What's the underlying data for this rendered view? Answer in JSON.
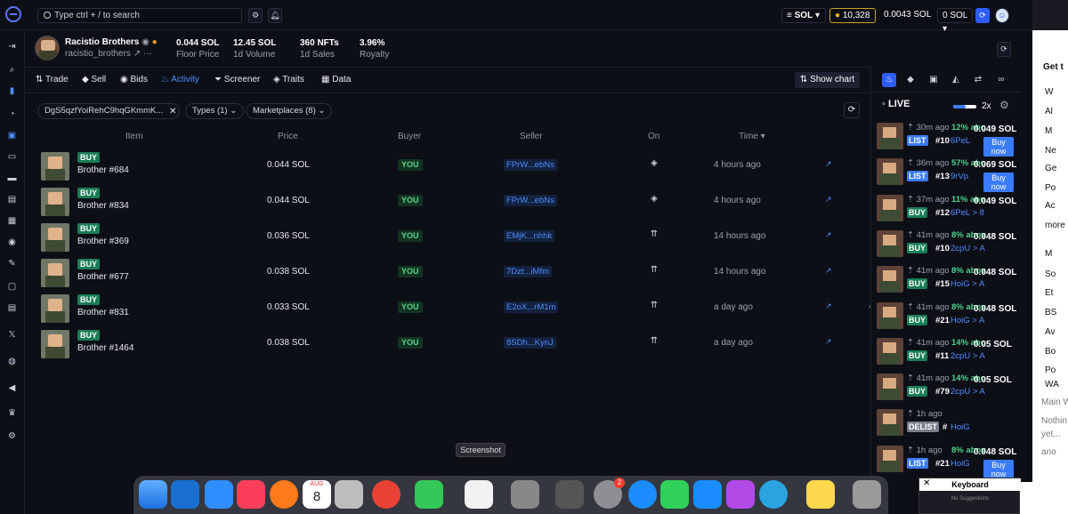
{
  "search": {
    "label": "Type  ctrl + /  to search"
  },
  "topbar": {
    "currency": "SOL",
    "points": "10,328",
    "balance1": "0.0043 SOL",
    "balance2": "0 SOL"
  },
  "collection": {
    "name": "Racistio Brothers",
    "slug": "racistio_brothers",
    "stats": [
      {
        "value": "0.044 SOL",
        "label": "Floor Price"
      },
      {
        "value": "12.45 SOL",
        "label": "1d Volume"
      },
      {
        "value": "360 NFTs",
        "label": "1d Sales"
      },
      {
        "value": "3.96%",
        "label": "Royalty"
      }
    ]
  },
  "tabs": [
    "Trade",
    "Sell",
    "Bids",
    "Activity",
    "Screener",
    "Traits",
    "Data"
  ],
  "active_tab": "Activity",
  "show_chart": "Show chart",
  "filters": {
    "address": "DgS5qzfYoiRehC9hqGKmmK...",
    "types": "Types (1)",
    "marketplaces": "Marketplaces (8)"
  },
  "columns": [
    "Item",
    "Price",
    "Buyer",
    "Seller",
    "On",
    "Time"
  ],
  "rows": [
    {
      "badge": "BUY",
      "name": "Brother #684",
      "price": "0.044 SOL",
      "buyer": "YOU",
      "seller": "FPrW...ebNs",
      "time": "4 hours ago"
    },
    {
      "badge": "BUY",
      "name": "Brother #834",
      "price": "0.044 SOL",
      "buyer": "YOU",
      "seller": "FPrW...ebNs",
      "time": "4 hours ago"
    },
    {
      "badge": "BUY",
      "name": "Brother #369",
      "price": "0.036 SOL",
      "buyer": "YOU",
      "seller": "EMjK...nhhk",
      "time": "14 hours ago"
    },
    {
      "badge": "BUY",
      "name": "Brother #677",
      "price": "0.038 SOL",
      "buyer": "YOU",
      "seller": "7Dzt...iMfm",
      "time": "14 hours ago"
    },
    {
      "badge": "BUY",
      "name": "Brother #831",
      "price": "0.033 SOL",
      "buyer": "YOU",
      "seller": "E2oX...rM1m",
      "time": "a day ago"
    },
    {
      "badge": "BUY",
      "name": "Brother #1464",
      "price": "0.038 SOL",
      "buyer": "YOU",
      "seller": "8SDh...KynJ",
      "time": "a day ago"
    }
  ],
  "live": {
    "title": "LIVE",
    "speed": "2x",
    "items": [
      {
        "ago": "30m ago",
        "pct": "12% abo",
        "price": "0.049 SOL",
        "badge": "LIST",
        "num": "#10",
        "who": "6PeL",
        "buynow": true
      },
      {
        "ago": "36m ago",
        "pct": "57% abo",
        "price": "0.069 SOL",
        "badge": "LIST",
        "num": "#13",
        "who": "9rVp",
        "buynow": true
      },
      {
        "ago": "37m ago",
        "pct": "11% abo",
        "price": "0.049 SOL",
        "badge": "BUY",
        "num": "#12",
        "who": "6PeL > 8",
        "buynow": false
      },
      {
        "ago": "41m ago",
        "pct": "8% abov",
        "price": "0.048 SOL",
        "badge": "BUY",
        "num": "#10",
        "who": "2cpU > A",
        "buynow": false
      },
      {
        "ago": "41m ago",
        "pct": "8% abov",
        "price": "0.048 SOL",
        "badge": "BUY",
        "num": "#15",
        "who": "HoiG > A",
        "buynow": false
      },
      {
        "ago": "41m ago",
        "pct": "8% abov",
        "price": "0.048 SOL",
        "badge": "BUY",
        "num": "#21",
        "who": "HoiG > A",
        "buynow": false
      },
      {
        "ago": "41m ago",
        "pct": "14% abo",
        "price": "0.05 SOL",
        "badge": "BUY",
        "num": "#11",
        "who": "2cpU > A",
        "buynow": false
      },
      {
        "ago": "41m ago",
        "pct": "14% abo",
        "price": "0.05 SOL",
        "badge": "BUY",
        "num": "#79",
        "who": "2cpU > A",
        "buynow": false
      },
      {
        "ago": "1h ago",
        "pct": "",
        "price": "",
        "badge": "DELIST",
        "num": "#",
        "who": "HoiG",
        "buynow": false
      },
      {
        "ago": "1h ago",
        "pct": "8% abov",
        "price": "0.048 SOL",
        "badge": "LIST",
        "num": "#21",
        "who": "HoiG",
        "buynow": true
      }
    ],
    "buynow_label": "Buy now"
  },
  "right_browser": {
    "items": [
      "Get t",
      "W",
      "Al",
      "M",
      "Ne",
      "Ge",
      "Po",
      "Ac",
      "more",
      "M",
      "So",
      "Et",
      "BS",
      "Av",
      "Bo",
      "Po",
      "WA",
      "Main W",
      "Nothin",
      "yet...",
      "ano"
    ]
  },
  "dock": {
    "tooltip": "Screenshot",
    "calendar_month": "AUG",
    "calendar_day": "8",
    "badge_count": "2"
  },
  "keyboard": {
    "title": "Keyboard",
    "hint": "No Suggestions"
  }
}
